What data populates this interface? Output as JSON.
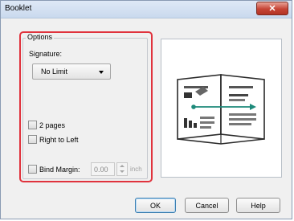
{
  "window": {
    "title": "Booklet"
  },
  "options": {
    "group_title": "Options",
    "signature_label": "Signature:",
    "signature_value": "No Limit",
    "two_pages_label": "2 pages",
    "right_to_left_label": "Right to Left",
    "bind_margin_label": "Bind Margin:",
    "bind_margin_value": "0.00",
    "bind_margin_unit": "inch"
  },
  "buttons": {
    "ok": "OK",
    "cancel": "Cancel",
    "help": "Help"
  },
  "colors": {
    "highlight": "#e0333d",
    "close": "#c64435"
  },
  "icons": [
    "close-icon",
    "dropdown-arrow-icon",
    "spin-up-icon",
    "spin-down-icon",
    "booklet-preview-icon"
  ]
}
